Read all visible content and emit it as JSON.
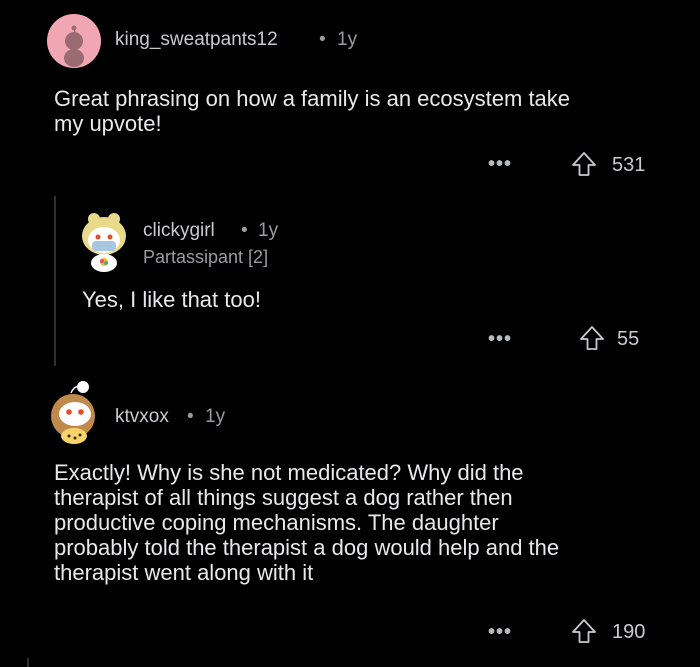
{
  "comments": [
    {
      "username": "king_sweatpants12",
      "separator": "•",
      "age": "1y",
      "body_lines": [
        "Great phrasing on how a family is an ecosystem take",
        "my upvote!"
      ],
      "more_label": "•••",
      "votes": "531"
    },
    {
      "username": "clickygirl",
      "separator": "•",
      "age": "1y",
      "flair": "Partassipant [2]",
      "body_lines": [
        "Yes, I like that too!"
      ],
      "more_label": "•••",
      "votes": "55"
    },
    {
      "username": "ktvxox",
      "separator": "•",
      "age": "1y",
      "body_lines": [
        "Exactly! Why is she not medicated? Why did the",
        "therapist of all things suggest a dog rather then",
        "productive coping mechanisms. The daughter",
        "probably told the therapist a dog would help and the",
        "therapist went along with it"
      ],
      "more_label": "•••",
      "votes": "190"
    }
  ],
  "icons": {
    "upvote": "upvote-arrow-icon",
    "avatar1": "snoo-avatar-icon",
    "avatar2": "snoo-avatar-mask-icon",
    "avatar3": "snoo-avatar-hair-icon"
  },
  "colors": {
    "background": "#000000",
    "avatar1_bg": "#f1a7b3"
  }
}
